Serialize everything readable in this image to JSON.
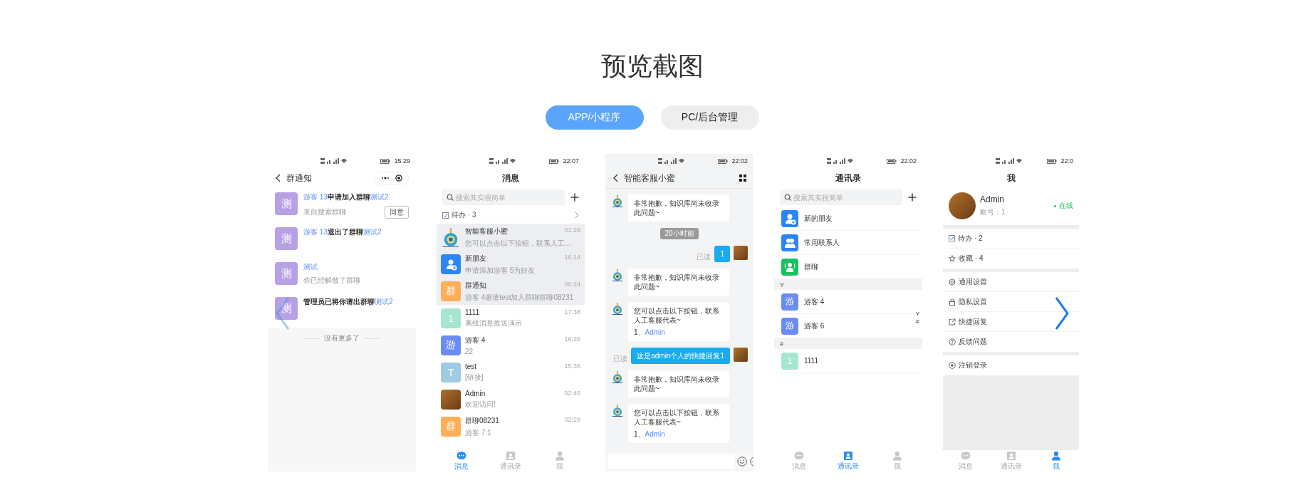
{
  "page_title": "预览截图",
  "tabs": [
    {
      "label": "APP/小程序",
      "selected": true
    },
    {
      "label": "PC/后台管理",
      "selected": false
    }
  ],
  "carousel": {
    "prev_disabled": true,
    "next_disabled": false
  },
  "screens": [
    {
      "kind": "notices",
      "time": "15:29",
      "title": "群通知",
      "items": [
        {
          "avatar": "测",
          "parts": [
            {
              "text": "游客 13",
              "highlight": true
            },
            {
              "text": "申请加入群聊",
              "highlight": false
            },
            {
              "text": "测试2",
              "highlight": true
            }
          ],
          "note": "来自搜索群聊",
          "action": "同意"
        },
        {
          "avatar": "测",
          "parts": [
            {
              "text": "游客 13",
              "highlight": true
            },
            {
              "text": "退出了群聊",
              "highlight": false
            },
            {
              "text": "测试2",
              "highlight": true
            }
          ]
        },
        {
          "avatar": "测",
          "parts": [
            {
              "text": "测试",
              "highlight": true
            }
          ],
          "note": "你已经解散了群聊"
        },
        {
          "avatar": "测",
          "parts": [
            {
              "text": "管理员已将你请出群聊",
              "highlight": false
            },
            {
              "text": "测试2",
              "highlight": true
            }
          ]
        }
      ],
      "footer": "没有更多了"
    },
    {
      "kind": "chats",
      "time": "22:07",
      "title": "消息",
      "search": {
        "placeholder": "搜索其实很简单"
      },
      "todo": "待办 · 3",
      "chats": [
        {
          "avatar": {
            "kind": "robot"
          },
          "name": "智能客服小蜜",
          "preview": "您可以点击以下按钮，联系人工...",
          "time": "01:29",
          "pinned": true
        },
        {
          "avatar": {
            "kind": "friend"
          },
          "name": "新朋友",
          "preview": "申请添加游客 5为好友",
          "time": "16:14",
          "pinned": true
        },
        {
          "avatar": {
            "kind": "letter",
            "letter": "群",
            "color": "#ffae57"
          },
          "name": "群通知",
          "preview": "游客 4邀请test加入群聊群聊08231",
          "time": "00:24",
          "pinned": true
        },
        {
          "avatar": {
            "kind": "letter",
            "letter": "1",
            "color": "#a6e6d0"
          },
          "name": "1111",
          "preview": "离线消息推送演示",
          "time": "17:38",
          "pinned": false
        },
        {
          "avatar": {
            "kind": "letter",
            "letter": "游",
            "color": "#6b8cf7"
          },
          "name": "游客 4",
          "preview": "22",
          "time": "16:26",
          "pinned": false
        },
        {
          "avatar": {
            "kind": "letter",
            "letter": "T",
            "color": "#9fcbe5"
          },
          "name": "test",
          "preview": "[链接]",
          "time": "15:36",
          "pinned": false
        },
        {
          "avatar": {
            "kind": "photo"
          },
          "name": "Admin",
          "preview": "欢迎访问!",
          "time": "02:46",
          "pinned": false
        },
        {
          "avatar": {
            "kind": "letter",
            "letter": "群",
            "color": "#ffae57"
          },
          "name": "群聊08231",
          "preview": "游客 7:1",
          "time": "02:29",
          "pinned": false
        }
      ],
      "tabbar": [
        {
          "kind": "chat",
          "label": "消息",
          "selected": true
        },
        {
          "kind": "contacts",
          "label": "通讯录",
          "selected": false
        },
        {
          "kind": "me",
          "label": "我",
          "selected": false
        }
      ]
    },
    {
      "kind": "chat",
      "time": "22:02",
      "title": "智能客服小蜜",
      "messages": [
        {
          "kind": "bot",
          "text": "非常抱歉，知识库尚未收录此问题~"
        },
        {
          "kind": "time",
          "text": "20小时前"
        },
        {
          "kind": "self",
          "text": "1",
          "status": "已读"
        },
        {
          "kind": "bot",
          "text": "非常抱歉，知识库尚未收录此问题~"
        },
        {
          "kind": "bot",
          "text": "您可以点击以下按钮，联系人工客服代表~",
          "option": "1、",
          "link": "Admin"
        },
        {
          "kind": "self",
          "text": "这是admin个人的快捷回复1",
          "status": "已读"
        },
        {
          "kind": "bot",
          "text": "非常抱歉，知识库尚未收录此问题~"
        },
        {
          "kind": "bot",
          "text": "您可以点击以下按钮，联系人工客服代表~",
          "option": "1、",
          "link": "Admin"
        }
      ]
    },
    {
      "kind": "contacts",
      "time": "22:02",
      "title": "通讯录",
      "search": {
        "placeholder": "搜索其实很简单"
      },
      "entries": [
        {
          "kind": "friend",
          "label": "新的朋友",
          "color": "#2b85f6"
        },
        {
          "kind": "people",
          "label": "常用联系人",
          "color": "#2b85f6"
        },
        {
          "kind": "group",
          "label": "群聊",
          "color": "#19c15f"
        }
      ],
      "sections": [
        {
          "header": "Y",
          "contacts": [
            {
              "letter": "游",
              "color": "#6b8cf7",
              "name": "游客 4"
            },
            {
              "letter": "游",
              "color": "#6b8cf7",
              "name": "游客 6"
            }
          ]
        },
        {
          "header": "#",
          "contacts": [
            {
              "letter": "1",
              "color": "#a6e6d0",
              "name": "1111"
            }
          ]
        }
      ],
      "index": [
        "Y",
        "#"
      ],
      "tabbar": [
        {
          "kind": "chat",
          "label": "消息",
          "selected": false
        },
        {
          "kind": "contacts",
          "label": "通讯录",
          "selected": true
        },
        {
          "kind": "me",
          "label": "我",
          "selected": false
        }
      ]
    },
    {
      "kind": "profile",
      "time": "22:0",
      "title": "我",
      "user": {
        "name": "Admin",
        "account": "账号：1",
        "status": "在线"
      },
      "menu_groups": [
        [
          {
            "kind": "todo",
            "label": "待办 · 2"
          },
          {
            "kind": "star",
            "label": "收藏 · 4"
          }
        ],
        [
          {
            "kind": "gear",
            "label": "通用设置"
          },
          {
            "kind": "lock",
            "label": "隐私设置"
          },
          {
            "kind": "share",
            "label": "快捷回复"
          },
          {
            "kind": "help",
            "label": "反馈问题"
          }
        ],
        [
          {
            "kind": "logout",
            "label": "注销登录"
          }
        ]
      ],
      "tabbar": [
        {
          "kind": "chat",
          "label": "消息",
          "selected": false
        },
        {
          "kind": "contacts",
          "label": "通讯录",
          "selected": false
        },
        {
          "kind": "me",
          "label": "我",
          "selected": true
        }
      ]
    }
  ]
}
